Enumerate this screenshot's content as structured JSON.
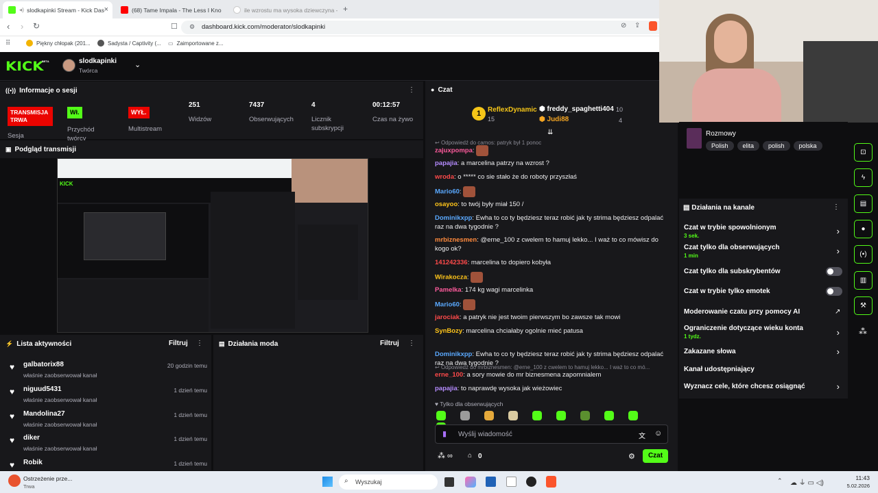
{
  "browser": {
    "tabs": [
      {
        "title": "slodkapinki Stream - Kick Das"
      },
      {
        "title": "(68) Tame Impala - The Less I Kno"
      },
      {
        "title": "ile wzrostu ma wysoka dziewczyna -"
      }
    ],
    "url": "dashboard.kick.com/moderator/slodkapinki",
    "bookmarks": [
      "Piękny chłopak (201...",
      "Sadysta / Captivity (...",
      "Zaimportowane z..."
    ]
  },
  "header": {
    "logo": "KICK",
    "beta": "BETA",
    "channel": "slodkapinki",
    "role": "Twórca"
  },
  "session": {
    "title": "Informacje o sesji",
    "live_badge": "TRANSMISJA TRWA",
    "session_label": "Sesja",
    "restream_badge": "Wł.",
    "restream_label": "Przychód twórcy",
    "multistream_badge": "WYŁ.",
    "multistream_label": "Multistream",
    "stats": [
      {
        "value": "251",
        "label": "Widzów"
      },
      {
        "value": "7437",
        "label": "Obserwujących"
      },
      {
        "value": "4",
        "label": "Licznik subskrypcji"
      },
      {
        "value": "00:12:57",
        "label": "Czas na żywo"
      }
    ]
  },
  "preview": {
    "title": "Podgląd transmisji"
  },
  "activity": {
    "title": "Lista aktywności",
    "filter": "Filtruj",
    "items": [
      {
        "name": "galbatorix88",
        "desc": "właśnie zaobserwował kanał",
        "time": "20 godzin temu"
      },
      {
        "name": "niguud5431",
        "desc": "właśnie zaobserwował kanał",
        "time": "1 dzień temu"
      },
      {
        "name": "Mandolina27",
        "desc": "właśnie zaobserwował kanał",
        "time": "1 dzień temu"
      },
      {
        "name": "diker",
        "desc": "właśnie zaobserwował kanał",
        "time": "1 dzień temu"
      },
      {
        "name": "Robik",
        "desc": "",
        "time": "1 dzień temu"
      }
    ]
  },
  "modactions": {
    "title": "Działania moda",
    "filter": "Filtruj"
  },
  "chat": {
    "title": "Czat",
    "leaders": [
      {
        "name": "ReflexDynamic",
        "count": "15"
      },
      {
        "name": "freddy_spaghetti404",
        "count": "10"
      },
      {
        "name": "Judi88",
        "count": "4"
      }
    ],
    "rank": "1",
    "reply1": "Odpowiedź do camos: patryk był 1 ponoc",
    "messages": [
      {
        "user": "zajuxpompa",
        "color": "#ff5b9d",
        "text": ""
      },
      {
        "user": "papajia",
        "color": "#b58cff",
        "text": "a marcelina patrzy na wzrost ?"
      },
      {
        "user": "wroda",
        "color": "#ff4a4a",
        "text": "o ***** co sie stało że do roboty przyszłaś"
      },
      {
        "user": "Mario60",
        "color": "#5aa9ff",
        "text": ""
      },
      {
        "user": "osayoo",
        "color": "#ffc51a",
        "text": "to twój były miał 150 /"
      },
      {
        "user": "Dominikxpp",
        "color": "#5aa9ff",
        "text": "Ewha to co ty będziesz teraz robić jak ty strima będziesz odpalać raz na dwa tygodnie ?"
      },
      {
        "user": "mrbiznesmen",
        "color": "#ff8a3d",
        "text": "@erne_100 z cwelem to hamuj lekko... I waż to co mówisz do kogo ok?"
      },
      {
        "user": "141242336",
        "color": "#ff4a4a",
        "text": "marcelina to dopiero kobyła"
      },
      {
        "user": "Wirakocza",
        "color": "#ffc51a",
        "text": ""
      },
      {
        "user": "Pamelka",
        "color": "#ff5b9d",
        "text": "174 kg wagi marcelinka"
      },
      {
        "user": "Mario60",
        "color": "#5aa9ff",
        "text": ""
      },
      {
        "user": "jarociak",
        "color": "#ff4a4a",
        "text": "a patryk nie jest twoim pierwszym bo zawsze tak mowi"
      },
      {
        "user": "SynBozy",
        "color": "#ffc51a",
        "text": "marcelina chciałaby ogolnie mieć patusa"
      },
      {
        "user": "Dominikxpp",
        "color": "#5aa9ff",
        "text": "Ewha to co ty będziesz teraz robić jak ty strima będziesz odpalać raz na dwa tygodnie ?"
      }
    ],
    "reply2": "Odpowiedź do mrbiznesmen: @erne_100 z cwelem to hamuj lekko... I waż to co mó...",
    "messages2": [
      {
        "user": "erne_100",
        "color": "#ff4a4a",
        "text": "a sory mowie do mr biznesmena zapomnialem"
      },
      {
        "user": "papajia",
        "color": "#b58cff",
        "text": "to naprawdę wysoka jak wieżowiec"
      }
    ],
    "followers_only": "Tylko dla obserwujących",
    "placeholder": "Wyślij wiadomość",
    "counter": "0",
    "send": "Czat"
  },
  "side": {
    "category": "Rozmowy",
    "tags": [
      "Polish",
      "elita",
      "polish",
      "polska"
    ],
    "actions_title": "Działania na kanale",
    "actions": [
      {
        "label": "Czat w trybie spowolnionym",
        "sub": "3 sek.",
        "type": "chevron"
      },
      {
        "label": "Czat tylko dla obserwujących",
        "sub": "1 min",
        "type": "chevron"
      },
      {
        "label": "Czat tylko dla subskrybentów",
        "sub": "",
        "type": "toggle"
      },
      {
        "label": "Czat w trybie tylko emotek",
        "sub": "",
        "type": "toggle"
      },
      {
        "label": "Moderowanie czatu przy pomocy AI",
        "sub": "",
        "type": "external"
      },
      {
        "label": "Ograniczenie dotyczące wieku konta",
        "sub": "1 tydz.",
        "type": "chevron"
      },
      {
        "label": "Zakazane słowa",
        "sub": "",
        "type": "chevron"
      },
      {
        "label": "Kanał udostępniający",
        "sub": "",
        "type": "none"
      },
      {
        "label": "Wyznacz cele, które chcesz osiągnąć",
        "sub": "",
        "type": "chevron"
      }
    ]
  },
  "taskbar": {
    "notification_title": "Ostrzeżenie prze...",
    "notification_sub": "Trwa",
    "search": "Wyszukaj",
    "time": "11:43",
    "date": "5.02.2026"
  }
}
